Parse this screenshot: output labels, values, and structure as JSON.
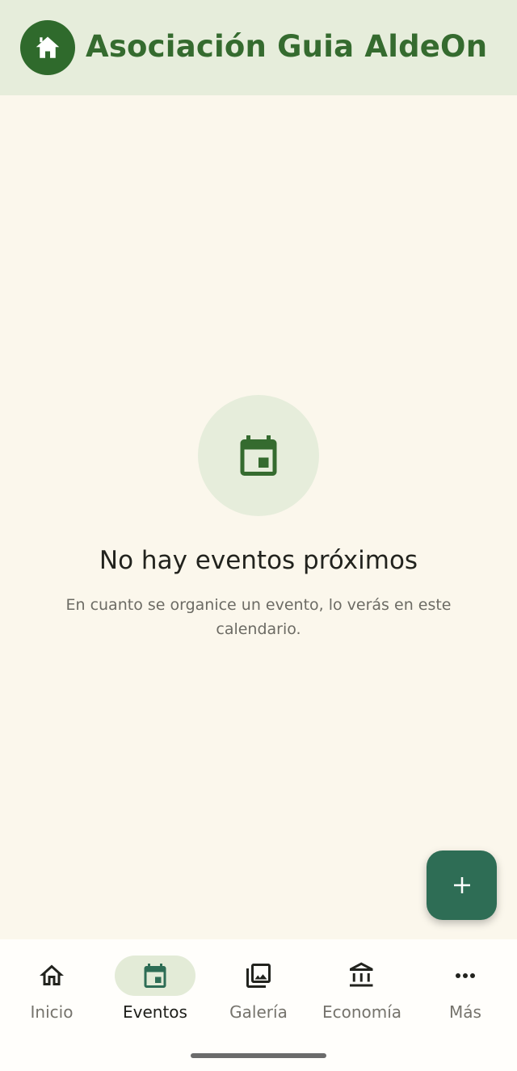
{
  "header": {
    "title": "Asociación Guia AldeOn",
    "logo_icon": "home-icon"
  },
  "empty_state": {
    "icon": "calendar-icon",
    "title": "No hay eventos próximos",
    "description": "En cuanto se organice un evento, lo verás en este calendario."
  },
  "fab": {
    "icon": "plus-icon"
  },
  "bottom_nav": {
    "items": [
      {
        "label": "Inicio",
        "icon": "home-outline-icon",
        "active": false
      },
      {
        "label": "Eventos",
        "icon": "calendar-icon",
        "active": true
      },
      {
        "label": "Galería",
        "icon": "photo-library-icon",
        "active": false
      },
      {
        "label": "Economía",
        "icon": "bank-icon",
        "active": false
      },
      {
        "label": "Más",
        "icon": "more-horizontal-icon",
        "active": false
      }
    ]
  },
  "colors": {
    "header_bg": "#e6eddb",
    "brand_green": "#2f6a2c",
    "page_bg": "#fbf7ec",
    "fab_bg": "#2e6d55",
    "active_pill": "#e3ebd7"
  }
}
